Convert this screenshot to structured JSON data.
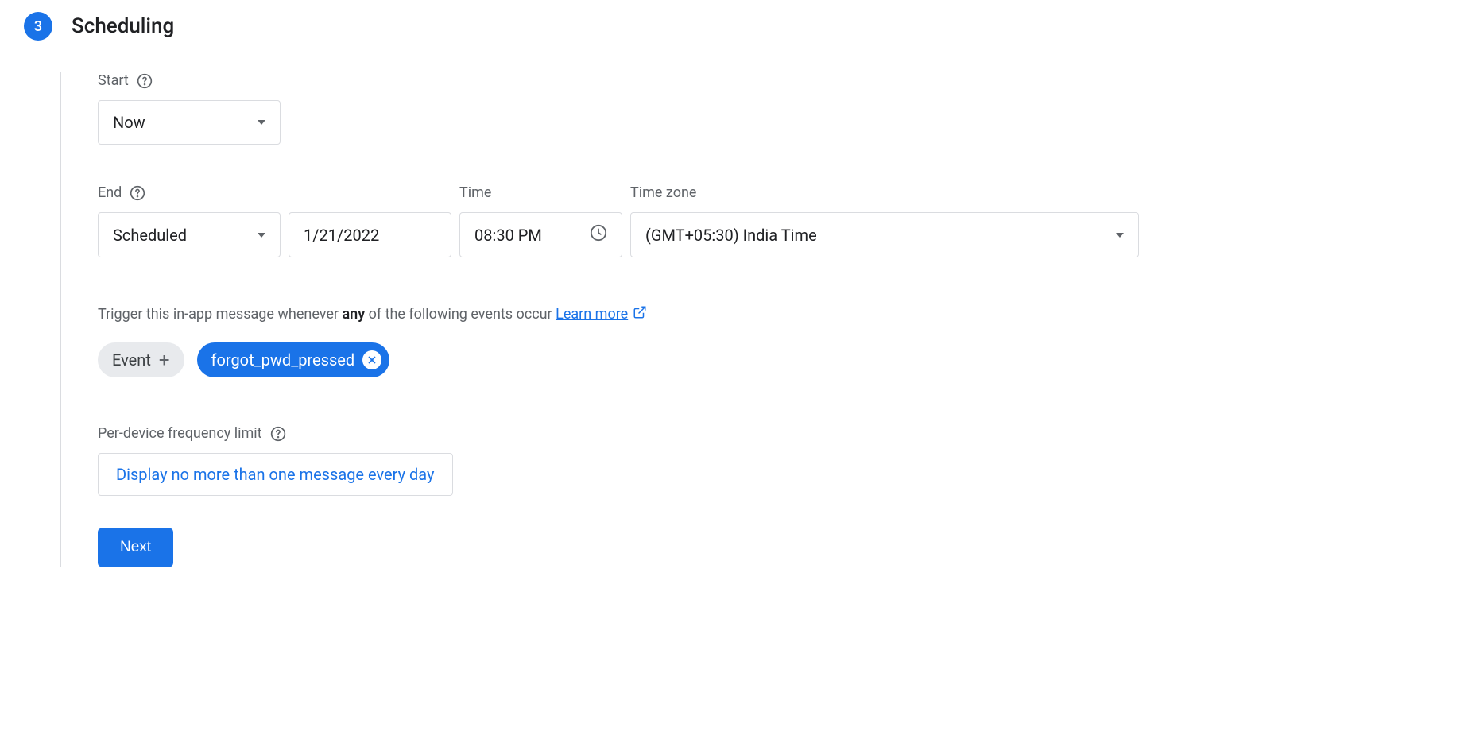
{
  "step": {
    "number": "3",
    "title": "Scheduling"
  },
  "start": {
    "label": "Start",
    "value": "Now"
  },
  "end": {
    "label": "End",
    "timeLabel": "Time",
    "tzLabel": "Time zone",
    "typeValue": "Scheduled",
    "dateValue": "1/21/2022",
    "timeValue": "08:30 PM",
    "tzValue": "(GMT+05:30) India Time"
  },
  "trigger": {
    "textPrefix": "Trigger this in-app message whenever ",
    "boldWord": "any",
    "textSuffix": " of the following events occur ",
    "learnMore": "Learn more",
    "eventChipLabel": "Event",
    "selectedEvent": "forgot_pwd_pressed"
  },
  "frequency": {
    "label": "Per-device frequency limit",
    "buttonText": "Display no more than one message every day"
  },
  "nextButton": "Next"
}
